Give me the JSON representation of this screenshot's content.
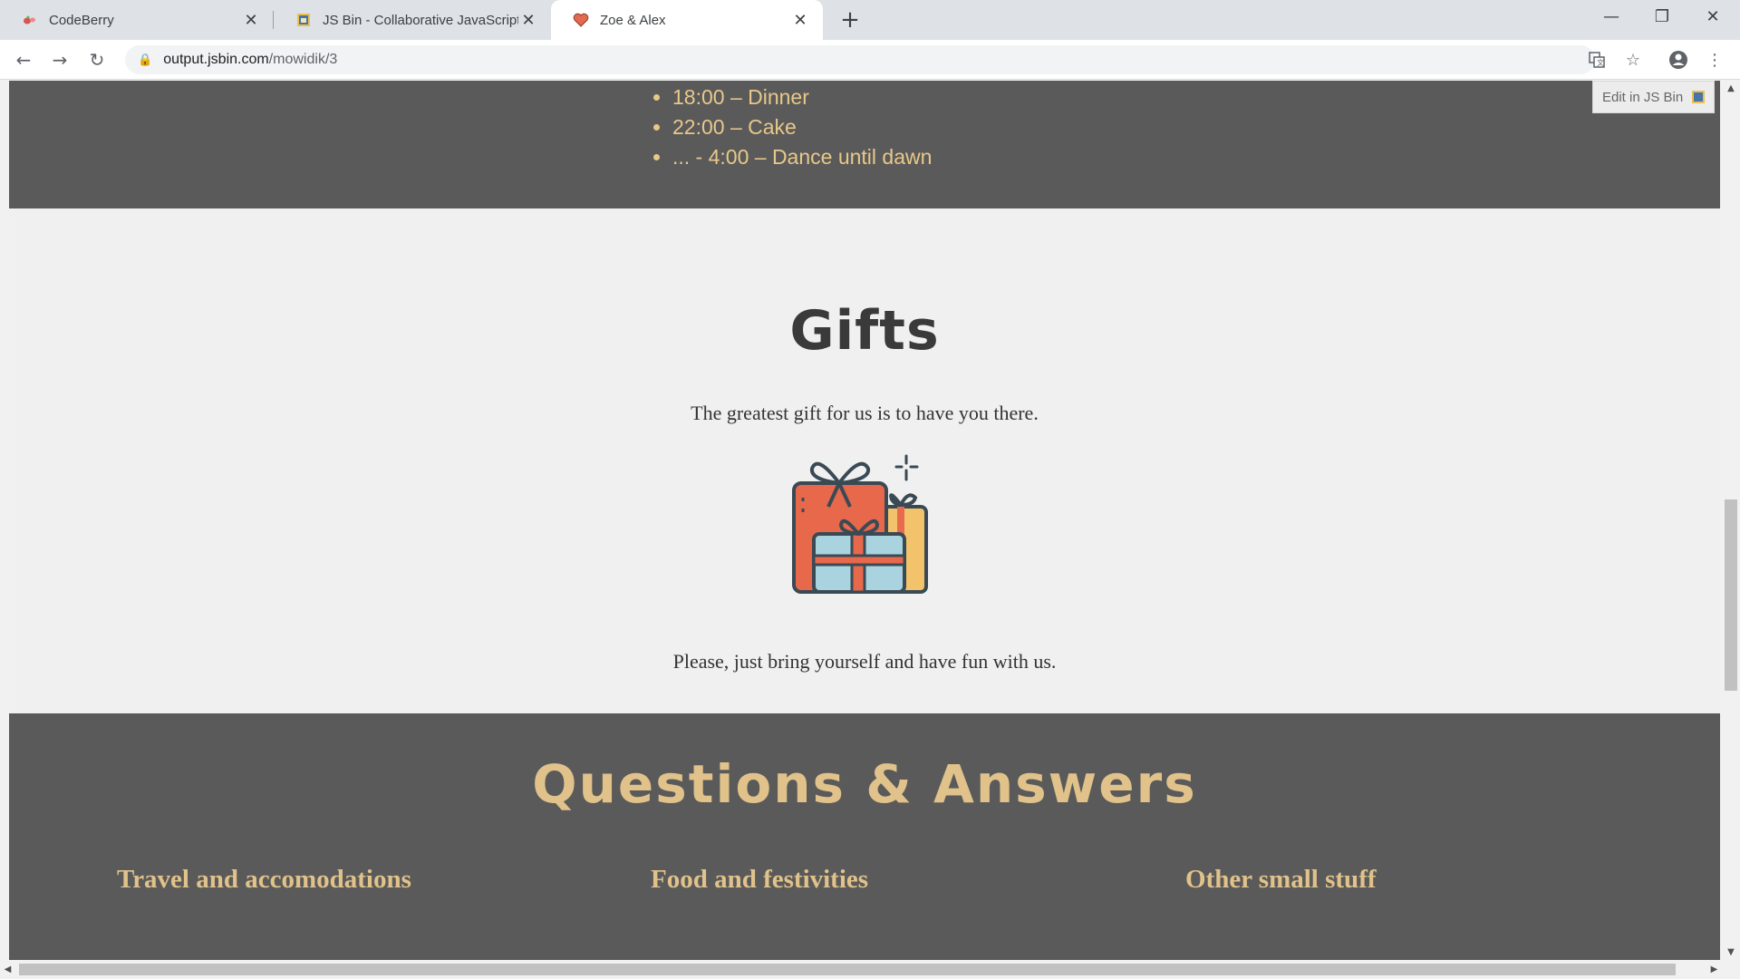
{
  "browser": {
    "tabs": [
      {
        "label": "CodeBerry",
        "icon": "codeberry-favicon"
      },
      {
        "label": "JS Bin - Collaborative JavaScript Debugging",
        "icon": "jsbin-favicon"
      },
      {
        "label": "Zoe & Alex",
        "icon": "heart-favicon",
        "active": true
      }
    ],
    "url_host": "output.jsbin.com",
    "url_path": "/mowidik/3"
  },
  "schedule": {
    "items": [
      "18:00 – Dinner",
      "22:00 – Cake",
      "... - 4:00 – Dance until dawn"
    ]
  },
  "gifts": {
    "title": "Gifts",
    "text1": "The greatest gift for us is to have you there.",
    "text2": "Please, just bring yourself and have fun with us.",
    "icon": "gift-boxes-icon"
  },
  "qa": {
    "title": "Questions & Answers",
    "columns": [
      "Travel and accomodations",
      "Food and festivities",
      "Other small stuff"
    ]
  },
  "edit_jsbin": {
    "label": "Edit in JS Bin"
  },
  "colors": {
    "dark_section": "#5a5a5a",
    "accent": "#e0c28a",
    "page_bg": "#f0f0f0"
  }
}
